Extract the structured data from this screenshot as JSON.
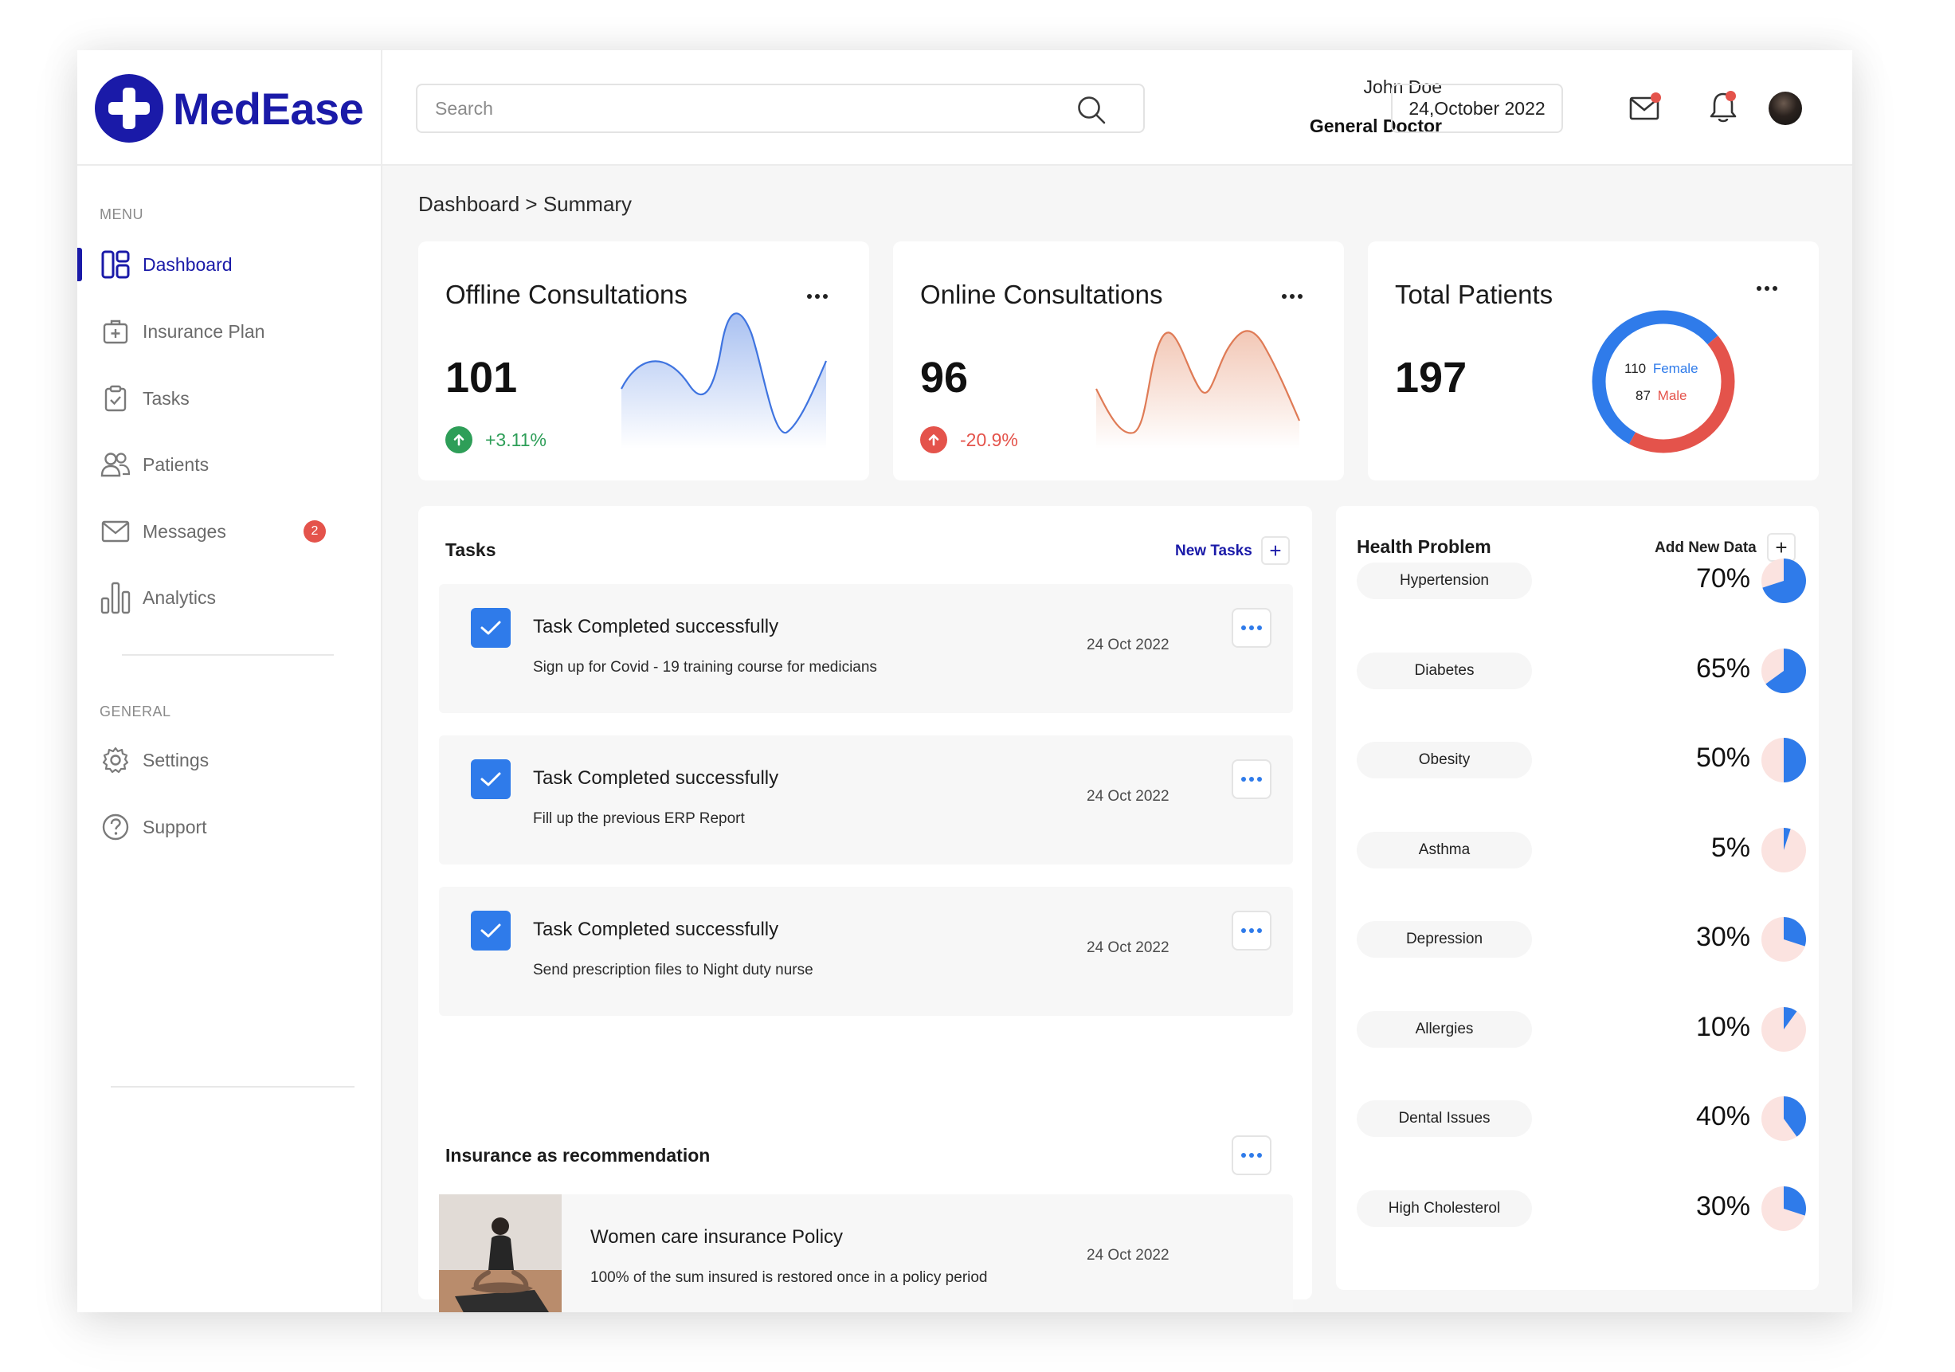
{
  "brand": {
    "name": "MedEase",
    "color": "#1a1aa8"
  },
  "search": {
    "placeholder": "Search"
  },
  "user": {
    "name": "John Doe",
    "role": "General Doctor"
  },
  "header": {
    "date": "24,October 2022",
    "icons": [
      "mail-icon",
      "bell-icon"
    ]
  },
  "sidebar": {
    "menu_label": "MENU",
    "items": [
      {
        "label": "Dashboard",
        "icon": "dashboard-icon",
        "active": true
      },
      {
        "label": "Insurance Plan",
        "icon": "insurance-icon"
      },
      {
        "label": "Tasks",
        "icon": "tasks-icon"
      },
      {
        "label": "Patients",
        "icon": "patients-icon"
      },
      {
        "label": "Messages",
        "icon": "mail-icon",
        "badge": "2"
      },
      {
        "label": "Analytics",
        "icon": "analytics-icon"
      }
    ],
    "general_label": "GENERAL",
    "general_items": [
      {
        "label": "Settings",
        "icon": "gear-icon"
      },
      {
        "label": "Support",
        "icon": "help-icon"
      }
    ]
  },
  "breadcrumb": "Dashboard > Summary",
  "stats": [
    {
      "title": "Offline Consultations",
      "value": "101",
      "change": "+3.11%",
      "direction": "up",
      "color": "#2e9e58"
    },
    {
      "title": "Online Consultations",
      "value": "96",
      "change": "-20.9%",
      "direction": "up",
      "color": "#e4534b"
    },
    {
      "title": "Total Patients",
      "value": "197",
      "female_count": "110",
      "female_label": "Female",
      "male_count": "87",
      "male_label": "Male",
      "female_color": "#2f7bea",
      "male_color": "#e4534b"
    }
  ],
  "tasks": {
    "title": "Tasks",
    "new_label": "New Tasks",
    "items": [
      {
        "title": "Task Completed successfully",
        "desc": "Sign up for Covid - 19 training course for medicians",
        "date": "24 Oct 2022"
      },
      {
        "title": "Task Completed successfully",
        "desc": "Fill up the previous ERP Report",
        "date": "24 Oct 2022"
      },
      {
        "title": "Task Completed successfully",
        "desc": "Send prescription files to Night duty nurse",
        "date": "24 Oct 2022"
      }
    ]
  },
  "insurance": {
    "title": "Insurance as recommendation",
    "item": {
      "title": "Women care insurance Policy",
      "desc": "100% of the sum insured is restored once in a policy period",
      "date": "24 Oct 2022"
    }
  },
  "health": {
    "title": "Health Problem",
    "add_label": "Add New Data",
    "items": [
      {
        "label": "Hypertension",
        "pct": "70%",
        "value": 70
      },
      {
        "label": "Diabetes",
        "pct": "65%",
        "value": 65
      },
      {
        "label": "Obesity",
        "pct": "50%",
        "value": 50
      },
      {
        "label": "Asthma",
        "pct": "5%",
        "value": 5
      },
      {
        "label": "Depression",
        "pct": "30%",
        "value": 30
      },
      {
        "label": "Allergies",
        "pct": "10%",
        "value": 10
      },
      {
        "label": "Dental Issues",
        "pct": "40%",
        "value": 40
      },
      {
        "label": "High Cholesterol",
        "pct": "30%",
        "value": 30
      }
    ]
  }
}
